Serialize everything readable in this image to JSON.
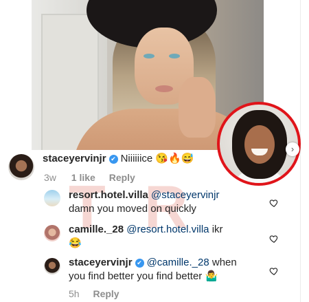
{
  "photo_post": {
    "next_arrow": "›"
  },
  "watermark": {
    "letters": [
      "T",
      "R"
    ]
  },
  "comments": [
    {
      "username": "staceyervinjr",
      "verified": true,
      "text": "Niiiiiice",
      "emojis": "😘🔥😅",
      "time": "3w",
      "likes": "1 like",
      "reply": "Reply"
    },
    {
      "username": "resort.hotel.villa",
      "mention": "@staceyervinjr",
      "text": "damn you moved on quickly"
    },
    {
      "username": "camille._28",
      "mention": "@resort.hotel.villa",
      "text": "ikr",
      "emojis": "😂"
    },
    {
      "username": "staceyervinjr",
      "verified": true,
      "mention": "@camille._28",
      "text": "when",
      "text_line2": "you find better you find better",
      "emojis": "🤷‍♂️",
      "time": "5h",
      "reply": "Reply"
    }
  ],
  "icons": {
    "verified": "✔",
    "like": "heart-outline-icon"
  },
  "colors": {
    "mention": "#00376b",
    "verified": "#3897f0",
    "circle_border": "#e0141a",
    "meta": "#8e8e8e"
  }
}
